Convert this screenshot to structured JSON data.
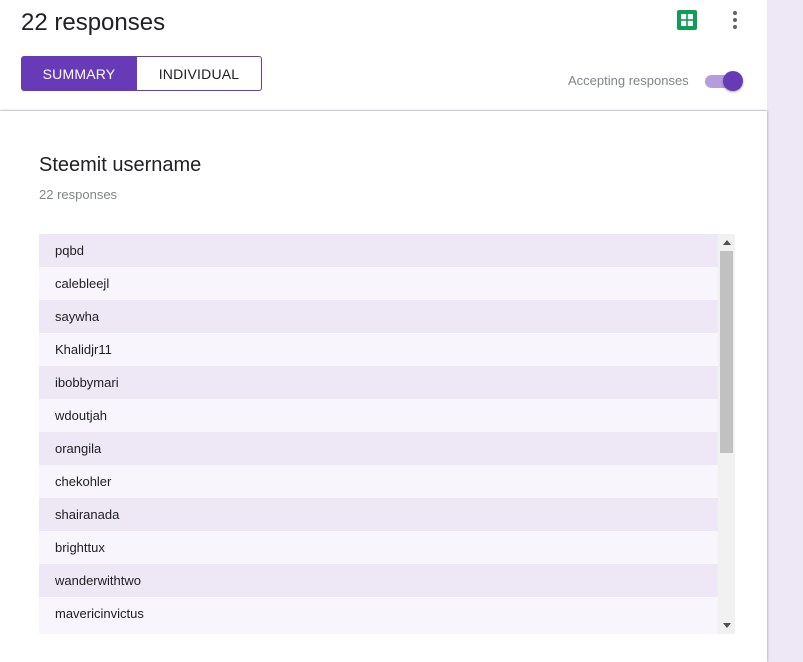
{
  "header": {
    "title": "22 responses",
    "tabs": [
      {
        "label": "SUMMARY",
        "active": true
      },
      {
        "label": "INDIVIDUAL",
        "active": false
      }
    ],
    "accepting_label": "Accepting responses",
    "accepting_on": true,
    "sheets_icon": "google-sheets-icon",
    "more_icon": "more-vert-icon"
  },
  "colors": {
    "accent": "#673ab7",
    "accent_light": "#b39ddb",
    "page_bg": "#ede7f6",
    "sheets_green": "#0f9d58"
  },
  "question": {
    "title": "Steemit username",
    "count": "22 responses",
    "responses": [
      "pqbd",
      "calebleejl",
      "saywha",
      "Khalidjr11",
      "ibobbymari",
      "wdoutjah",
      "orangila",
      "chekohler",
      "shairanada",
      "brighttux",
      "wanderwithtwo",
      "mavericinvictus"
    ]
  }
}
